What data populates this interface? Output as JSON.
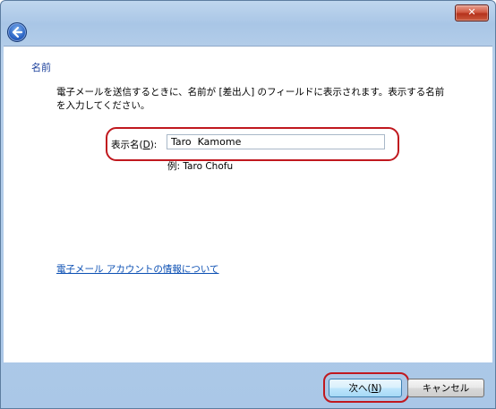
{
  "titlebar": {
    "close_label": "✕"
  },
  "page": {
    "title": "名前",
    "description": "電子メールを送信するときに、名前が [差出人] のフィールドに表示されます。表示する名前を入力してください。"
  },
  "form": {
    "display_name_label_prefix": "表示名(",
    "display_name_accesskey": "D",
    "display_name_label_suffix": "):",
    "display_name_value": "Taro  Kamome",
    "example": "例: Taro Chofu"
  },
  "link": {
    "account_info": "電子メール アカウントの情報について"
  },
  "buttons": {
    "next_prefix": "次へ(",
    "next_accesskey": "N",
    "next_suffix": ")",
    "cancel": "キャンセル"
  },
  "colors": {
    "highlight": "#c0181e",
    "title": "#1a3f9b",
    "link": "#0b4fb3"
  }
}
